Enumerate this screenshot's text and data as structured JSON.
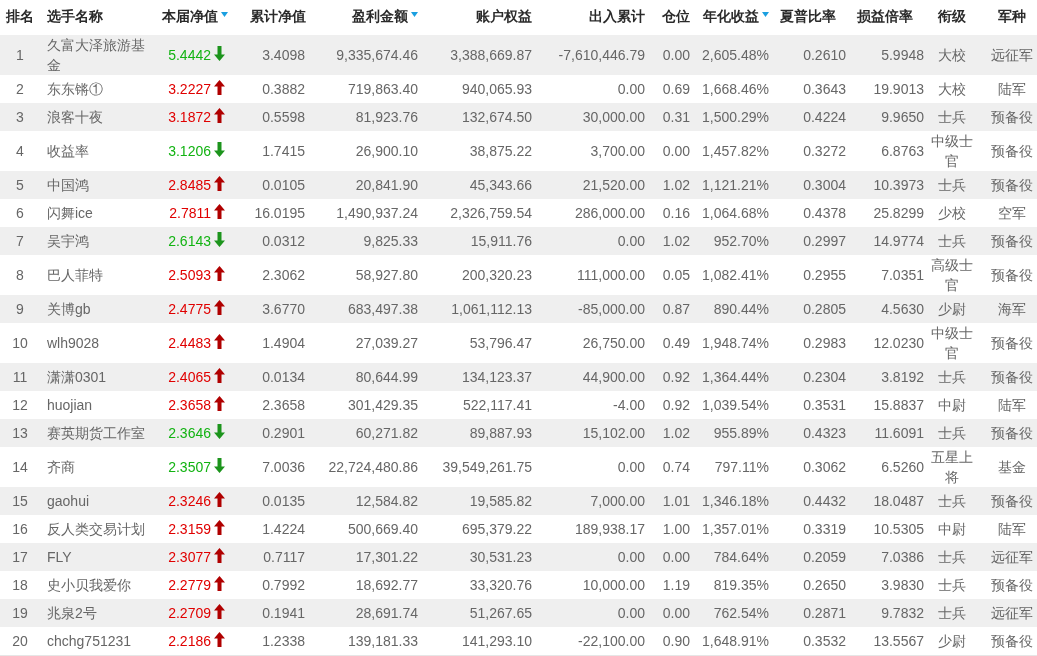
{
  "table": {
    "columns": [
      {
        "label": "排名",
        "sort_indicator": false
      },
      {
        "label": "选手名称",
        "sort_indicator": false
      },
      {
        "label": "本届净值",
        "sort_indicator": true
      },
      {
        "label": "累计净值",
        "sort_indicator": false
      },
      {
        "label": "盈利金额",
        "sort_indicator": true
      },
      {
        "label": "账户权益",
        "sort_indicator": false
      },
      {
        "label": "出入累计",
        "sort_indicator": false
      },
      {
        "label": "仓位",
        "sort_indicator": false
      },
      {
        "label": "年化收益",
        "sort_indicator": true
      },
      {
        "label": "夏普比率",
        "sort_indicator": false
      },
      {
        "label": "损益倍率",
        "sort_indicator": false
      },
      {
        "label": "衔级",
        "sort_indicator": false
      },
      {
        "label": "军种",
        "sort_indicator": false
      }
    ],
    "rows": [
      {
        "rising": false,
        "cells": [
          "1",
          "久富大泽旅游基金",
          "5.4442",
          "3.4098",
          "9,335,674.46",
          "3,388,669.87",
          "-7,610,446.79",
          "0.00",
          "2,605.48%",
          "0.2610",
          "5.9948",
          "大校",
          "远征军"
        ]
      },
      {
        "rising": true,
        "cells": [
          "2",
          "东东锵①",
          "3.2227",
          "0.3882",
          "719,863.40",
          "940,065.93",
          "0.00",
          "0.69",
          "1,668.46%",
          "0.3643",
          "19.9013",
          "大校",
          "陆军"
        ]
      },
      {
        "rising": true,
        "cells": [
          "3",
          "浪客十夜",
          "3.1872",
          "0.5598",
          "81,923.76",
          "132,674.50",
          "30,000.00",
          "0.31",
          "1,500.29%",
          "0.4224",
          "9.9650",
          "士兵",
          "预备役"
        ]
      },
      {
        "rising": false,
        "cells": [
          "4",
          "收益率",
          "3.1206",
          "1.7415",
          "26,900.10",
          "38,875.22",
          "3,700.00",
          "0.00",
          "1,457.82%",
          "0.3272",
          "6.8763",
          "中级士官",
          "预备役"
        ]
      },
      {
        "rising": true,
        "cells": [
          "5",
          "中国鸿",
          "2.8485",
          "0.0105",
          "20,841.90",
          "45,343.66",
          "21,520.00",
          "1.02",
          "1,121.21%",
          "0.3004",
          "10.3973",
          "士兵",
          "预备役"
        ]
      },
      {
        "rising": true,
        "cells": [
          "6",
          "闪舞ice",
          "2.7811",
          "16.0195",
          "1,490,937.24",
          "2,326,759.54",
          "286,000.00",
          "0.16",
          "1,064.68%",
          "0.4378",
          "25.8299",
          "少校",
          "空军"
        ]
      },
      {
        "rising": false,
        "cells": [
          "7",
          "吴宇鸿",
          "2.6143",
          "0.0312",
          "9,825.33",
          "15,911.76",
          "0.00",
          "1.02",
          "952.70%",
          "0.2997",
          "14.9774",
          "士兵",
          "预备役"
        ]
      },
      {
        "rising": true,
        "cells": [
          "8",
          "巴人菲特",
          "2.5093",
          "2.3062",
          "58,927.80",
          "200,320.23",
          "111,000.00",
          "0.05",
          "1,082.41%",
          "0.2955",
          "7.0351",
          "高级士官",
          "预备役"
        ]
      },
      {
        "rising": true,
        "cells": [
          "9",
          "关博gb",
          "2.4775",
          "3.6770",
          "683,497.38",
          "1,061,112.13",
          "-85,000.00",
          "0.87",
          "890.44%",
          "0.2805",
          "4.5630",
          "少尉",
          "海军"
        ]
      },
      {
        "rising": true,
        "cells": [
          "10",
          "wlh9028",
          "2.4483",
          "1.4904",
          "27,039.27",
          "53,796.47",
          "26,750.00",
          "0.49",
          "1,948.74%",
          "0.2983",
          "12.0230",
          "中级士官",
          "预备役"
        ]
      },
      {
        "rising": true,
        "cells": [
          "11",
          "潇潇0301",
          "2.4065",
          "0.0134",
          "80,644.99",
          "134,123.37",
          "44,900.00",
          "0.92",
          "1,364.44%",
          "0.2304",
          "3.8192",
          "士兵",
          "预备役"
        ]
      },
      {
        "rising": true,
        "cells": [
          "12",
          "huojian",
          "2.3658",
          "2.3658",
          "301,429.35",
          "522,117.41",
          "-4.00",
          "0.92",
          "1,039.54%",
          "0.3531",
          "15.8837",
          "中尉",
          "陆军"
        ]
      },
      {
        "rising": false,
        "cells": [
          "13",
          "赛英期货工作室",
          "2.3646",
          "0.2901",
          "60,271.82",
          "89,887.93",
          "15,102.00",
          "1.02",
          "955.89%",
          "0.4323",
          "11.6091",
          "士兵",
          "预备役"
        ]
      },
      {
        "rising": false,
        "cells": [
          "14",
          "齐商",
          "2.3507",
          "7.0036",
          "22,724,480.86",
          "39,549,261.75",
          "0.00",
          "0.74",
          "797.11%",
          "0.3062",
          "6.5260",
          "五星上将",
          "基金"
        ]
      },
      {
        "rising": true,
        "cells": [
          "15",
          "gaohui",
          "2.3246",
          "0.0135",
          "12,584.82",
          "19,585.82",
          "7,000.00",
          "1.01",
          "1,346.18%",
          "0.4432",
          "18.0487",
          "士兵",
          "预备役"
        ]
      },
      {
        "rising": true,
        "cells": [
          "16",
          "反人类交易计划",
          "2.3159",
          "1.4224",
          "500,669.40",
          "695,379.22",
          "189,938.17",
          "1.00",
          "1,357.01%",
          "0.3319",
          "10.5305",
          "中尉",
          "陆军"
        ]
      },
      {
        "rising": true,
        "cells": [
          "17",
          "FLY",
          "2.3077",
          "0.7117",
          "17,301.22",
          "30,531.23",
          "0.00",
          "0.00",
          "784.64%",
          "0.2059",
          "7.0386",
          "士兵",
          "远征军"
        ]
      },
      {
        "rising": true,
        "cells": [
          "18",
          "史小贝我爱你",
          "2.2779",
          "0.7992",
          "18,692.77",
          "33,320.76",
          "10,000.00",
          "1.19",
          "819.35%",
          "0.2650",
          "3.9830",
          "士兵",
          "预备役"
        ]
      },
      {
        "rising": true,
        "cells": [
          "19",
          "兆泉2号",
          "2.2709",
          "0.1941",
          "28,691.74",
          "51,267.65",
          "0.00",
          "0.00",
          "762.54%",
          "0.2871",
          "9.7832",
          "士兵",
          "远征军"
        ]
      },
      {
        "rising": true,
        "cells": [
          "20",
          "chchg751231",
          "2.2186",
          "1.2338",
          "139,181.33",
          "141,293.10",
          "-22,100.00",
          "0.90",
          "1,648.91%",
          "0.3532",
          "13.5567",
          "少尉",
          "预备役"
        ]
      }
    ]
  }
}
